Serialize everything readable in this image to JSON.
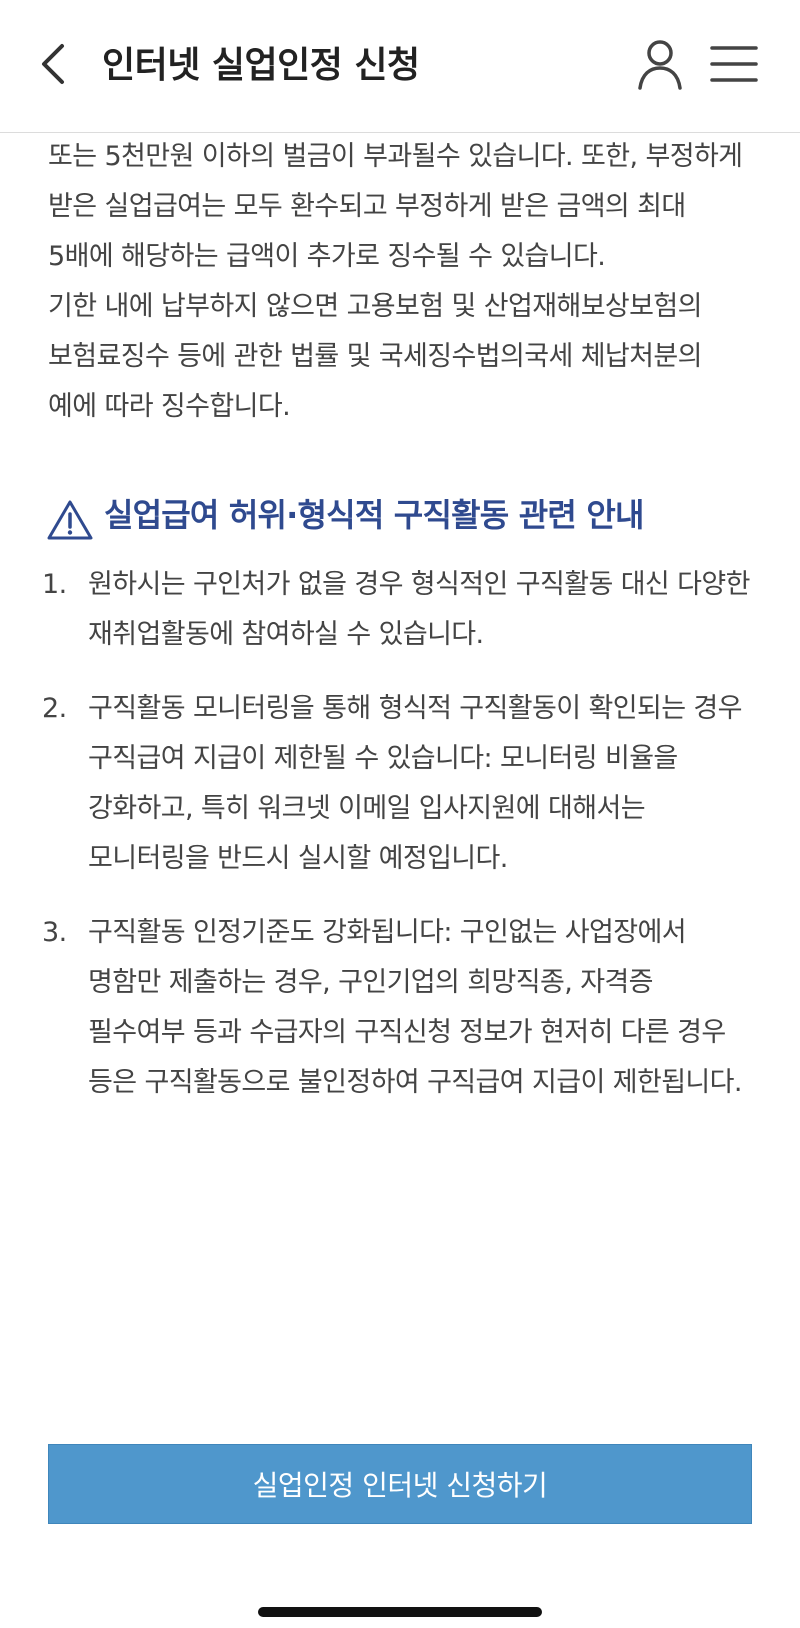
{
  "header": {
    "title": "인터넷 실업인정 신청",
    "back_icon": "chevron-left-icon",
    "user_icon": "user-icon",
    "menu_icon": "hamburger-menu-icon"
  },
  "content": {
    "paragraph1": "또는 5천만원 이하의 벌금이 부과될수 있습니다. 또한, 부정하게 받은 실업급여는 모두 환수되고 부정하게 받은 금액의 최대 5배에 해당하는 급액이 추가로 징수될 수 있습니다.",
    "paragraph2": "기한 내에 납부하지 않으면 고용보험 및 산업재해보상보험의 보험료징수 등에 관한 법률 및 국세징수법의국세 체납처분의 예에 따라 징수합니다.",
    "notice": {
      "icon": "warning-icon",
      "title": "실업급여 허위·형식적 구직활동 관련 안내",
      "items": [
        {
          "num": "1.",
          "text": "원하시는 구인처가 없을 경우 형식적인 구직활동 대신 다양한 재취업활동에 참여하실 수 있습니다."
        },
        {
          "num": "2.",
          "text": "구직활동 모니터링을 통해 형식적 구직활동이 확인되는 경우 구직급여 지급이 제한될 수 있습니다: 모니터링 비율을 강화하고, 특히 워크넷 이메일 입사지원에 대해서는 모니터링을 반드시 실시할 예정입니다."
        },
        {
          "num": "3.",
          "text": "구직활동 인정기준도 강화됩니다: 구인없는 사업장에서 명함만 제출하는 경우, 구인기업의 희망직종, 자격증 필수여부 등과 수급자의 구직신청 정보가 현저히 다른 경우 등은 구직활동으로 불인정하여 구직급여 지급이 제한됩니다."
        }
      ]
    }
  },
  "footer": {
    "apply_button": "실업인정 인터넷 신청하기"
  },
  "colors": {
    "accent_title": "#2f4a8f",
    "button_bg": "#4f97cc",
    "body_text": "#444444"
  }
}
